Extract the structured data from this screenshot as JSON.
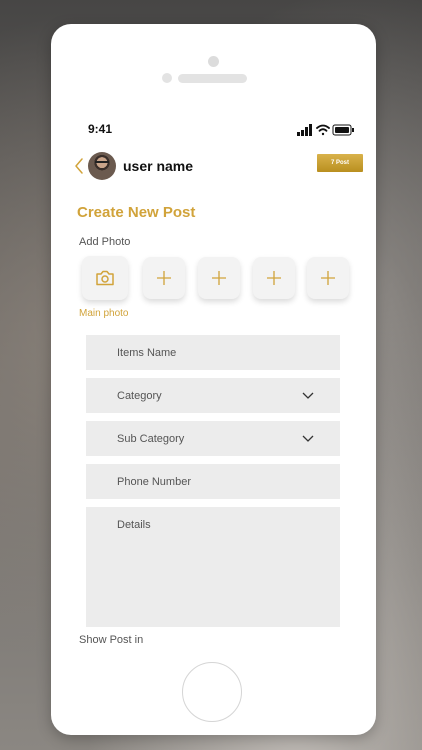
{
  "status_bar": {
    "time": "9:41"
  },
  "header": {
    "user_name": "user name",
    "post_badge": "7 Post"
  },
  "page": {
    "title": "Create New Post",
    "add_photo_label": "Add Photo",
    "main_photo_label": "Main photo",
    "show_post_label": "Show Post in"
  },
  "form": {
    "items_name_placeholder": "Items Name",
    "category_label": "Category",
    "sub_category_label": "Sub Category",
    "phone_placeholder": "Phone Number",
    "details_placeholder": "Details"
  },
  "colors": {
    "accent": "#d1a33a",
    "field_bg": "#ececec",
    "badge": "#c9a032"
  },
  "icons": [
    "back-chevron-icon",
    "camera-icon",
    "plus-icon",
    "chevron-down-icon",
    "signal-icon",
    "wifi-icon",
    "battery-icon"
  ]
}
